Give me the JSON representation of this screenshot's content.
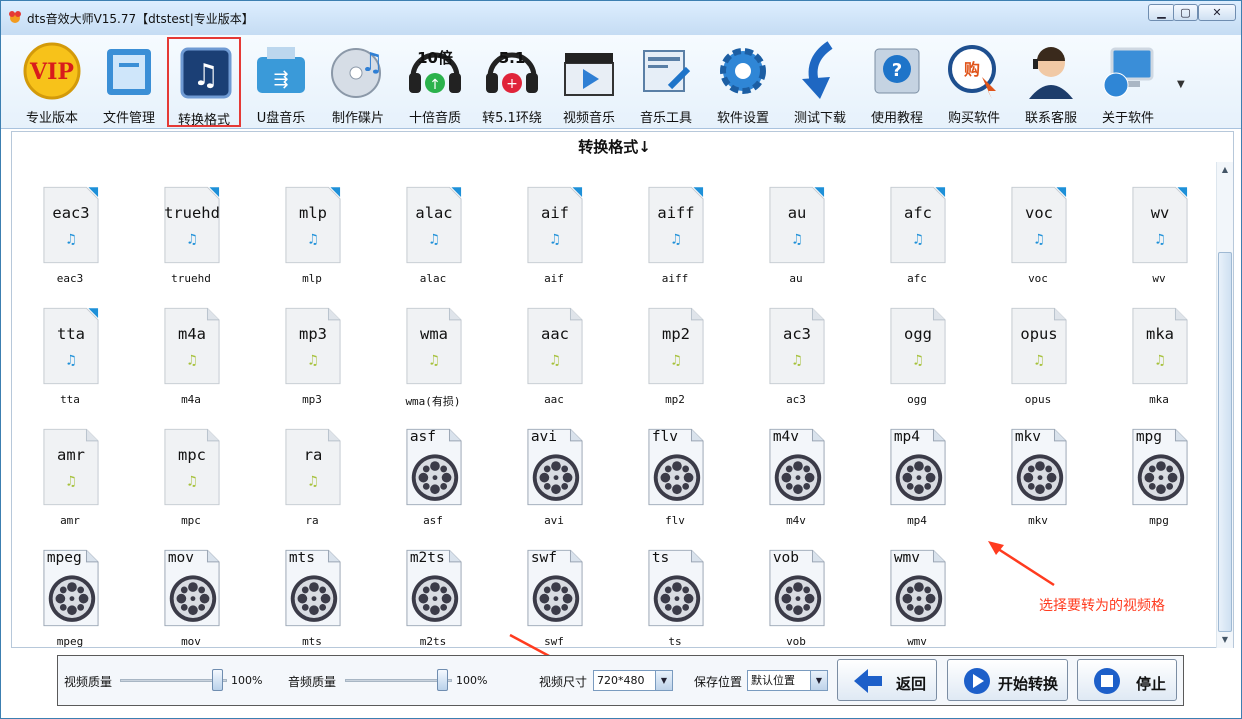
{
  "window": {
    "title": "dts音效大师V15.77【dtstest|专业版本】",
    "min": "▁",
    "max": "▢",
    "close": "✕"
  },
  "toolbar": [
    {
      "label": "专业版本",
      "icon": "vip-badge-icon"
    },
    {
      "label": "文件管理",
      "icon": "folder-icon"
    },
    {
      "label": "转换格式",
      "icon": "music-note-icon",
      "selected": true
    },
    {
      "label": "U盘音乐",
      "icon": "usb-drive-icon"
    },
    {
      "label": "制作碟片",
      "icon": "cd-music-icon"
    },
    {
      "label": "十倍音质",
      "icon": "headphones-10x-icon",
      "badge": "10倍"
    },
    {
      "label": "转5.1环绕",
      "icon": "headphones-51-icon",
      "badge": "5.1"
    },
    {
      "label": "视频音乐",
      "icon": "clapperboard-icon"
    },
    {
      "label": "音乐工具",
      "icon": "tools-icon"
    },
    {
      "label": "软件设置",
      "icon": "gear-icon"
    },
    {
      "label": "测试下载",
      "icon": "download-arrow-icon"
    },
    {
      "label": "使用教程",
      "icon": "help-book-icon"
    },
    {
      "label": "购买软件",
      "icon": "buy-click-icon",
      "badge": "购"
    },
    {
      "label": "联系客服",
      "icon": "support-agent-icon"
    },
    {
      "label": "关于软件",
      "icon": "computer-globe-icon"
    }
  ],
  "content": {
    "title": "转换格式↓"
  },
  "formats": [
    {
      "name": "eac3",
      "label": "eac3",
      "kind": "audio-blue"
    },
    {
      "name": "truehd",
      "label": "truehd",
      "kind": "audio-blue"
    },
    {
      "name": "mlp",
      "label": "mlp",
      "kind": "audio-blue"
    },
    {
      "name": "alac",
      "label": "alac",
      "kind": "audio-blue"
    },
    {
      "name": "aif",
      "label": "aif",
      "kind": "audio-blue"
    },
    {
      "name": "aiff",
      "label": "aiff",
      "kind": "audio-blue"
    },
    {
      "name": "au",
      "label": "au",
      "kind": "audio-blue"
    },
    {
      "name": "afc",
      "label": "afc",
      "kind": "audio-blue"
    },
    {
      "name": "voc",
      "label": "voc",
      "kind": "audio-blue"
    },
    {
      "name": "wv",
      "label": "wv",
      "kind": "audio-blue"
    },
    {
      "name": "tta",
      "label": "tta",
      "kind": "audio-blue"
    },
    {
      "name": "m4a",
      "label": "m4a",
      "kind": "audio-green"
    },
    {
      "name": "mp3",
      "label": "mp3",
      "kind": "audio-green"
    },
    {
      "name": "wma",
      "label": "wma(有损)",
      "kind": "audio-green"
    },
    {
      "name": "aac",
      "label": "aac",
      "kind": "audio-green"
    },
    {
      "name": "mp2",
      "label": "mp2",
      "kind": "audio-green"
    },
    {
      "name": "ac3",
      "label": "ac3",
      "kind": "audio-green"
    },
    {
      "name": "ogg",
      "label": "ogg",
      "kind": "audio-green"
    },
    {
      "name": "opus",
      "label": "opus",
      "kind": "audio-green"
    },
    {
      "name": "mka",
      "label": "mka",
      "kind": "audio-green"
    },
    {
      "name": "amr",
      "label": "amr",
      "kind": "audio-green"
    },
    {
      "name": "mpc",
      "label": "mpc",
      "kind": "audio-green"
    },
    {
      "name": "ra",
      "label": "ra",
      "kind": "audio-green"
    },
    {
      "name": "asf",
      "label": "asf",
      "kind": "video"
    },
    {
      "name": "avi",
      "label": "avi",
      "kind": "video"
    },
    {
      "name": "flv",
      "label": "flv",
      "kind": "video"
    },
    {
      "name": "m4v",
      "label": "m4v",
      "kind": "video"
    },
    {
      "name": "mp4",
      "label": "mp4",
      "kind": "video"
    },
    {
      "name": "mkv",
      "label": "mkv",
      "kind": "video"
    },
    {
      "name": "mpg",
      "label": "mpg",
      "kind": "video"
    },
    {
      "name": "mpeg",
      "label": "mpeg",
      "kind": "video"
    },
    {
      "name": "mov",
      "label": "mov",
      "kind": "video"
    },
    {
      "name": "mts",
      "label": "mts",
      "kind": "video"
    },
    {
      "name": "m2ts",
      "label": "m2ts",
      "kind": "video"
    },
    {
      "name": "swf",
      "label": "swf",
      "kind": "video"
    },
    {
      "name": "ts",
      "label": "ts",
      "kind": "video"
    },
    {
      "name": "vob",
      "label": "vob",
      "kind": "video"
    },
    {
      "name": "wmv",
      "label": "wmv",
      "kind": "video"
    }
  ],
  "annotation": {
    "text": "选择要转为的视频格"
  },
  "bottom": {
    "video_quality_label": "视频质量",
    "video_quality_value": "100%",
    "video_quality_level": 1.0,
    "audio_quality_label": "音频质量",
    "audio_quality_value": "100%",
    "audio_quality_level": 1.0,
    "video_size_label": "视频尺寸",
    "video_size_value": "720*480",
    "save_location_label": "保存位置",
    "save_location_value": "默认位置",
    "back_label": "返回",
    "start_label": "开始转换",
    "stop_label": "停止"
  },
  "colors": {
    "accent_red": "#e53935",
    "annotation": "#ff3b1f",
    "audio_blue_note": "#1e90d8",
    "audio_green_note": "#a6c13a"
  }
}
